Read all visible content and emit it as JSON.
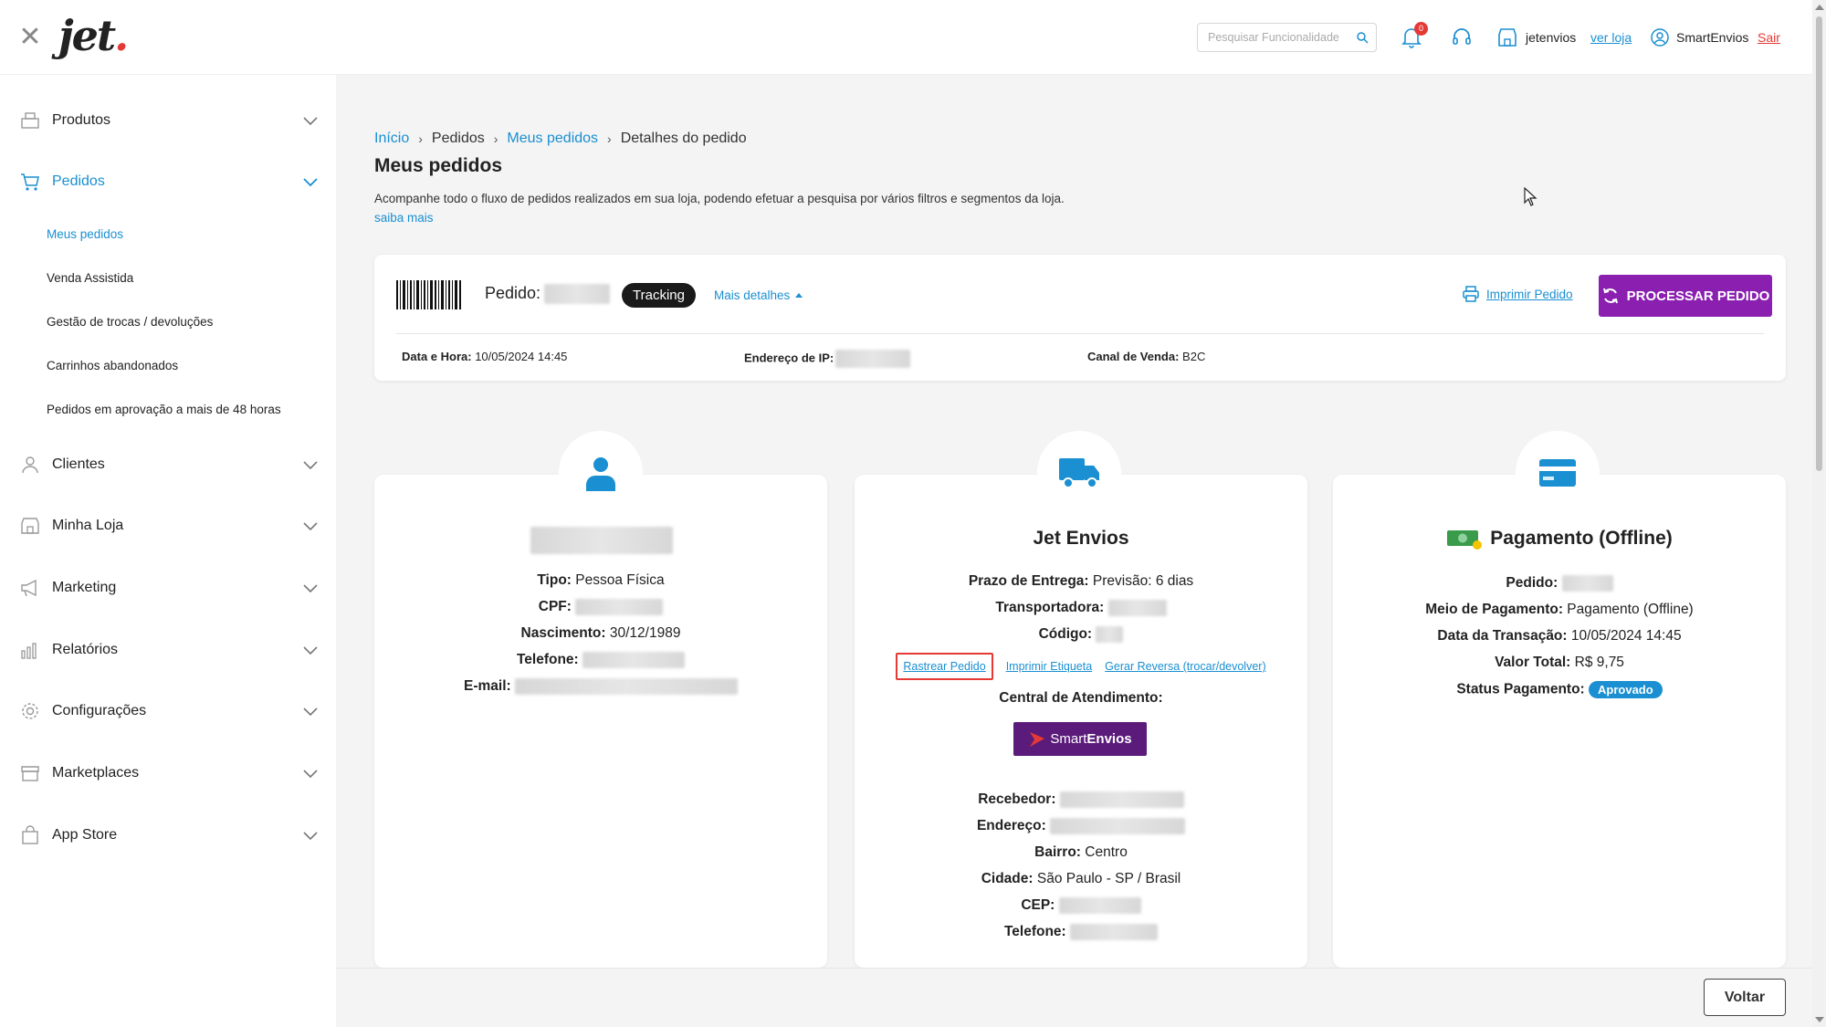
{
  "header": {
    "logo": "jet",
    "search_placeholder": "Pesquisar Funcionalidade",
    "notifications_count": "0",
    "store_name": "jetenvios",
    "ver_loja": "ver loja",
    "user_name": "SmartEnvios",
    "logout": "Sair"
  },
  "sidebar": {
    "items": [
      {
        "label": "Produtos",
        "icon": "box-icon"
      },
      {
        "label": "Pedidos",
        "icon": "cart-icon"
      },
      {
        "label": "Clientes",
        "icon": "person-icon"
      },
      {
        "label": "Minha Loja",
        "icon": "store-icon"
      },
      {
        "label": "Marketing",
        "icon": "megaphone-icon"
      },
      {
        "label": "Relatórios",
        "icon": "chart-icon"
      },
      {
        "label": "Configurações",
        "icon": "gear-icon"
      },
      {
        "label": "Marketplaces",
        "icon": "marketplace-icon"
      },
      {
        "label": "App Store",
        "icon": "bag-icon"
      }
    ],
    "pedidos_sub": [
      "Meus pedidos",
      "Venda Assistida",
      "Gestão de trocas / devoluções",
      "Carrinhos abandonados",
      "Pedidos em aprovação a mais de 48 horas"
    ]
  },
  "breadcrumb": [
    "Início",
    "Pedidos",
    "Meus pedidos",
    "Detalhes do pedido"
  ],
  "page": {
    "title": "Meus pedidos",
    "description": "Acompanhe todo o fluxo de pedidos realizados em sua loja, podendo efetuar a pesquisa por vários filtros e segmentos da loja.",
    "saiba_mais": "saiba mais"
  },
  "order": {
    "pedido_label": "Pedido:",
    "tracking": "Tracking",
    "mais_detalhes": "Mais detalhes",
    "imprimir": "Imprimir Pedido",
    "processar": "PROCESSAR PEDIDO",
    "data_label": "Data e Hora:",
    "data_value": "10/05/2024 14:45",
    "ip_label": "Endereço de IP:",
    "canal_label": "Canal de Venda:",
    "canal_value": "B2C"
  },
  "customer": {
    "tipo_label": "Tipo:",
    "tipo_value": "Pessoa Física",
    "cpf_label": "CPF:",
    "nascimento_label": "Nascimento:",
    "nascimento_value": "30/12/1989",
    "telefone_label": "Telefone:",
    "email_label": "E-mail:"
  },
  "shipping": {
    "title": "Jet Envios",
    "prazo_label": "Prazo de Entrega:",
    "prazo_value": "Previsão: 6 dias",
    "transportadora_label": "Transportadora:",
    "codigo_label": "Código:",
    "rastrear": "Rastrear Pedido",
    "imprimir_etiqueta": "Imprimir Etiqueta",
    "gerar_reversa": "Gerar Reversa (trocar/devolver)",
    "central": "Central de Atendimento:",
    "brand_a": "Smart",
    "brand_b": "Envios",
    "recebedor_label": "Recebedor:",
    "endereco_label": "Endereço:",
    "bairro_label": "Bairro:",
    "bairro_value": "Centro",
    "cidade_label": "Cidade:",
    "cidade_value": "São Paulo - SP / Brasil",
    "cep_label": "CEP:",
    "telefone_label": "Telefone:"
  },
  "payment": {
    "title": "Pagamento (Offline)",
    "pedido_label": "Pedido:",
    "meio_label": "Meio de Pagamento:",
    "meio_value": "Pagamento (Offline)",
    "data_label": "Data da Transação:",
    "data_value": "10/05/2024 14:45",
    "valor_label": "Valor Total:",
    "valor_value": "R$ 9,75",
    "status_label": "Status Pagamento:",
    "status_value": "Aprovado"
  },
  "footer": {
    "voltar": "Voltar"
  },
  "colors": {
    "accent": "#1a8fd1",
    "primary_button": "#8a1fb0",
    "danger": "#e53935"
  }
}
